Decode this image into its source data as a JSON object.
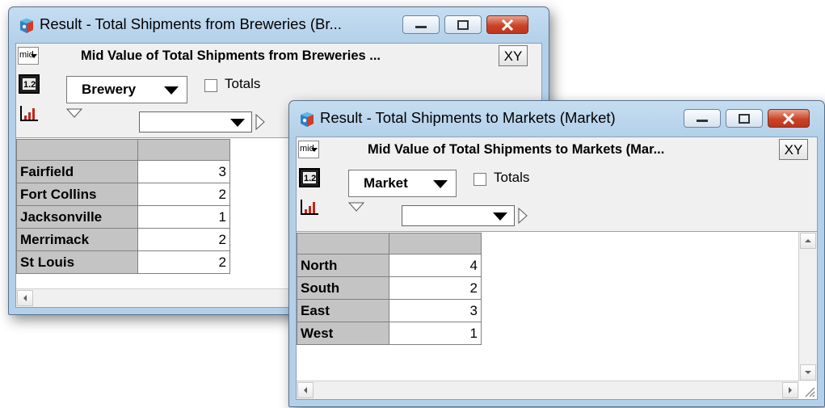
{
  "windows": [
    {
      "title": "Result - Total Shipments from Breweries (Br...",
      "mid_label": "mid",
      "result_title": "Mid Value of Total Shipments from Breweries ...",
      "xy_label": "XY",
      "index_dropdown": "Brewery",
      "totals_label": "Totals",
      "rows": [
        {
          "label": "Fairfield",
          "value": "3"
        },
        {
          "label": "Fort Collins",
          "value": "2"
        },
        {
          "label": "Jacksonville",
          "value": "1"
        },
        {
          "label": "Merrimack",
          "value": "2"
        },
        {
          "label": "St Louis",
          "value": "2"
        }
      ]
    },
    {
      "title": "Result - Total Shipments to Markets (Market)",
      "mid_label": "mid",
      "result_title": "Mid Value of Total Shipments to Markets (Mar...",
      "xy_label": "XY",
      "index_dropdown": "Market",
      "totals_label": "Totals",
      "rows": [
        {
          "label": "North",
          "value": "4"
        },
        {
          "label": "South",
          "value": "2"
        },
        {
          "label": "East",
          "value": "3"
        },
        {
          "label": "West",
          "value": "1"
        }
      ]
    }
  ],
  "icons": {
    "app": "analytica-app-icon",
    "table_view": "table-view-icon",
    "graph_view": "graph-view-icon",
    "minimize": "minimize-icon",
    "maximize": "maximize-icon",
    "close": "close-icon"
  },
  "colors": {
    "title_bar": "#b9d4ec",
    "close_button": "#c9442a",
    "header_cell": "#c4c4c4"
  }
}
